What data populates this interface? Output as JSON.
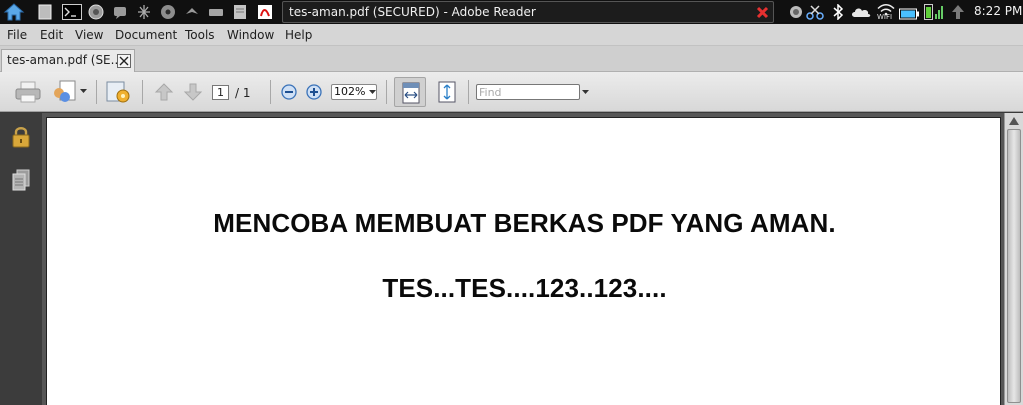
{
  "system_panel": {
    "window_title": "tes-aman.pdf (SECURED) - Adobe Reader",
    "clock": "8:22 PM",
    "wifi_label": "WIFI"
  },
  "menu": {
    "items": [
      "File",
      "Edit",
      "View",
      "Document",
      "Tools",
      "Window",
      "Help"
    ]
  },
  "tab": {
    "label": "tes-aman.pdf (SE..."
  },
  "toolbar": {
    "page_current": "1",
    "page_total": "/ 1",
    "zoom": "102%",
    "find_placeholder": "Find"
  },
  "document": {
    "lines": [
      "MENCOBA MEMBUAT BERKAS PDF YANG AMAN.",
      "TES...TES....123..123...."
    ]
  },
  "colors": {
    "title_underline": "#e01818",
    "panel_bg": "#101010",
    "doc_bg": "#575757"
  }
}
